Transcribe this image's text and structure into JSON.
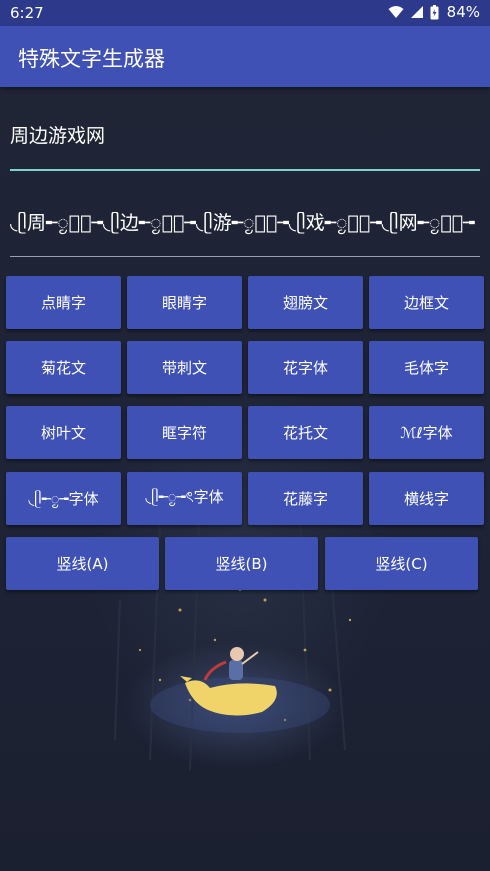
{
  "status_bar": {
    "time": "6:27",
    "battery": "84%"
  },
  "app": {
    "title": "特殊文字生成器"
  },
  "input": {
    "value": "周边游戏网"
  },
  "output": {
    "value": "◟ᥫ周╾ᮬ⌓ᮬ╼◟ᥫ边╾ᮬ⌓ᮬ╼◟ᥫ游╾ᮬ⌓ᮬ╼◟ᥫ戏╾ᮬ⌓ᮬ╼◟ᥫ网╾ᮬ⌓ᮬ╼"
  },
  "buttons": {
    "row1": [
      "点睛字",
      "眼睛字",
      "翅膀文",
      "边框文"
    ],
    "row2": [
      "菊花文",
      "带刺文",
      "花字体",
      "毛体字"
    ],
    "row3": [
      "树叶文",
      "眶字符",
      "花托文",
      "ℳℓ字体"
    ],
    "row4": [
      "◟ᥫ╾ᮬ╼字体",
      "◟ᥫ╾ᮬ╼ৎ字体",
      "花藤字",
      "横线字"
    ],
    "row5": [
      "竖线(A)",
      "竖线(B)",
      "竖线(C)"
    ]
  },
  "colors": {
    "primary": "#3f51b5",
    "primary_dark": "#2d3a8c",
    "accent_underline": "#7fd3cf",
    "background": "#1e2434"
  },
  "icons": [
    "wifi-icon",
    "signal-icon",
    "battery-icon"
  ]
}
